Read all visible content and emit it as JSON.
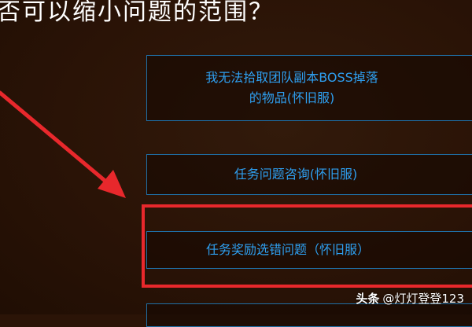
{
  "question": "否可以缩小问题的范围？",
  "options": [
    {
      "line1": "我无法拾取团队副本BOSS掉落",
      "line2": "的物品(怀旧服)"
    },
    {
      "label": "任务问题咨询(怀旧服)"
    },
    {
      "label": "任务奖励选错问题（怀旧服）"
    }
  ],
  "watermark": {
    "brand": "头条",
    "handle": "@灯灯登登123"
  },
  "colors": {
    "background": "#2b1407",
    "option_text": "#2e9ff0",
    "option_border": "#1f6fa6",
    "highlight": "#e8282c",
    "arrow": "#e8282c"
  }
}
